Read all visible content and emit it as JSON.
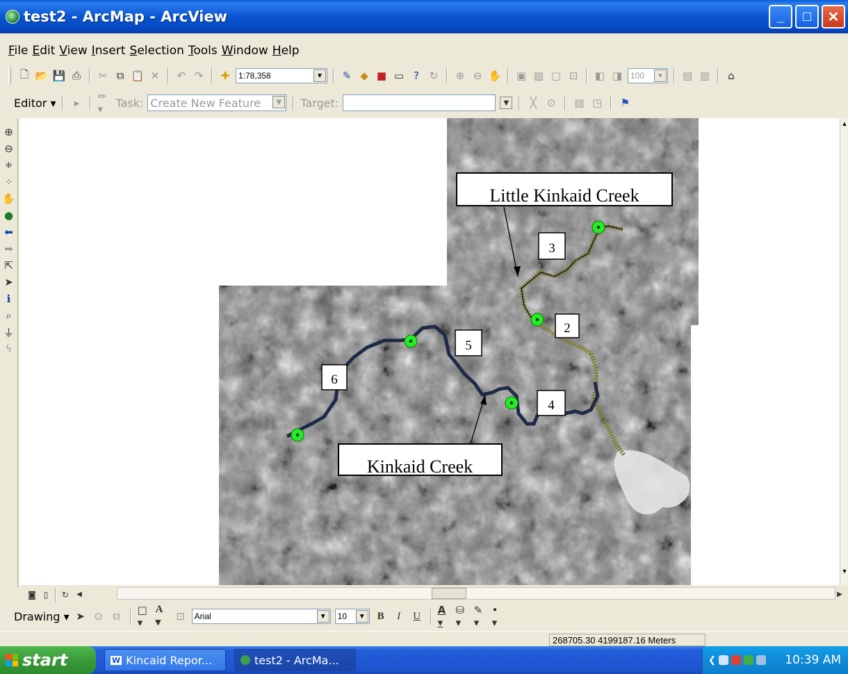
{
  "window": {
    "title": "test2 - ArcMap - ArcView",
    "minimize": "_",
    "maximize": "□",
    "close": "✕"
  },
  "menu": [
    "File",
    "Edit",
    "View",
    "Insert",
    "Selection",
    "Tools",
    "Window",
    "Help"
  ],
  "toolbar": {
    "scale_value": "1:78,358",
    "zoom_percent": "100"
  },
  "editor": {
    "editor_label": "Editor",
    "task_label": "Task:",
    "task_value": "Create New Feature",
    "target_label": "Target:",
    "target_value": ""
  },
  "map": {
    "labels": {
      "little_kinkaid": "Little Kinkaid Creek",
      "kinkaid": "Kinkaid Creek",
      "n2": "2",
      "n3": "3",
      "n4": "4",
      "n5": "5",
      "n6": "6"
    },
    "colors": {
      "point": "#22ee22",
      "creek_main": "#1f2a48",
      "creek_trib": "#8a8a30"
    }
  },
  "drawing": {
    "label": "Drawing",
    "font": "Arial",
    "size": "10",
    "bold": "B",
    "italic": "I",
    "underline": "U"
  },
  "status": {
    "coords": "268705.30  4199187.16 Meters"
  },
  "taskbar": {
    "start": "start",
    "items": [
      "Kincaid Repor...",
      "test2 - ArcMa..."
    ],
    "clock": "10:39 AM"
  }
}
